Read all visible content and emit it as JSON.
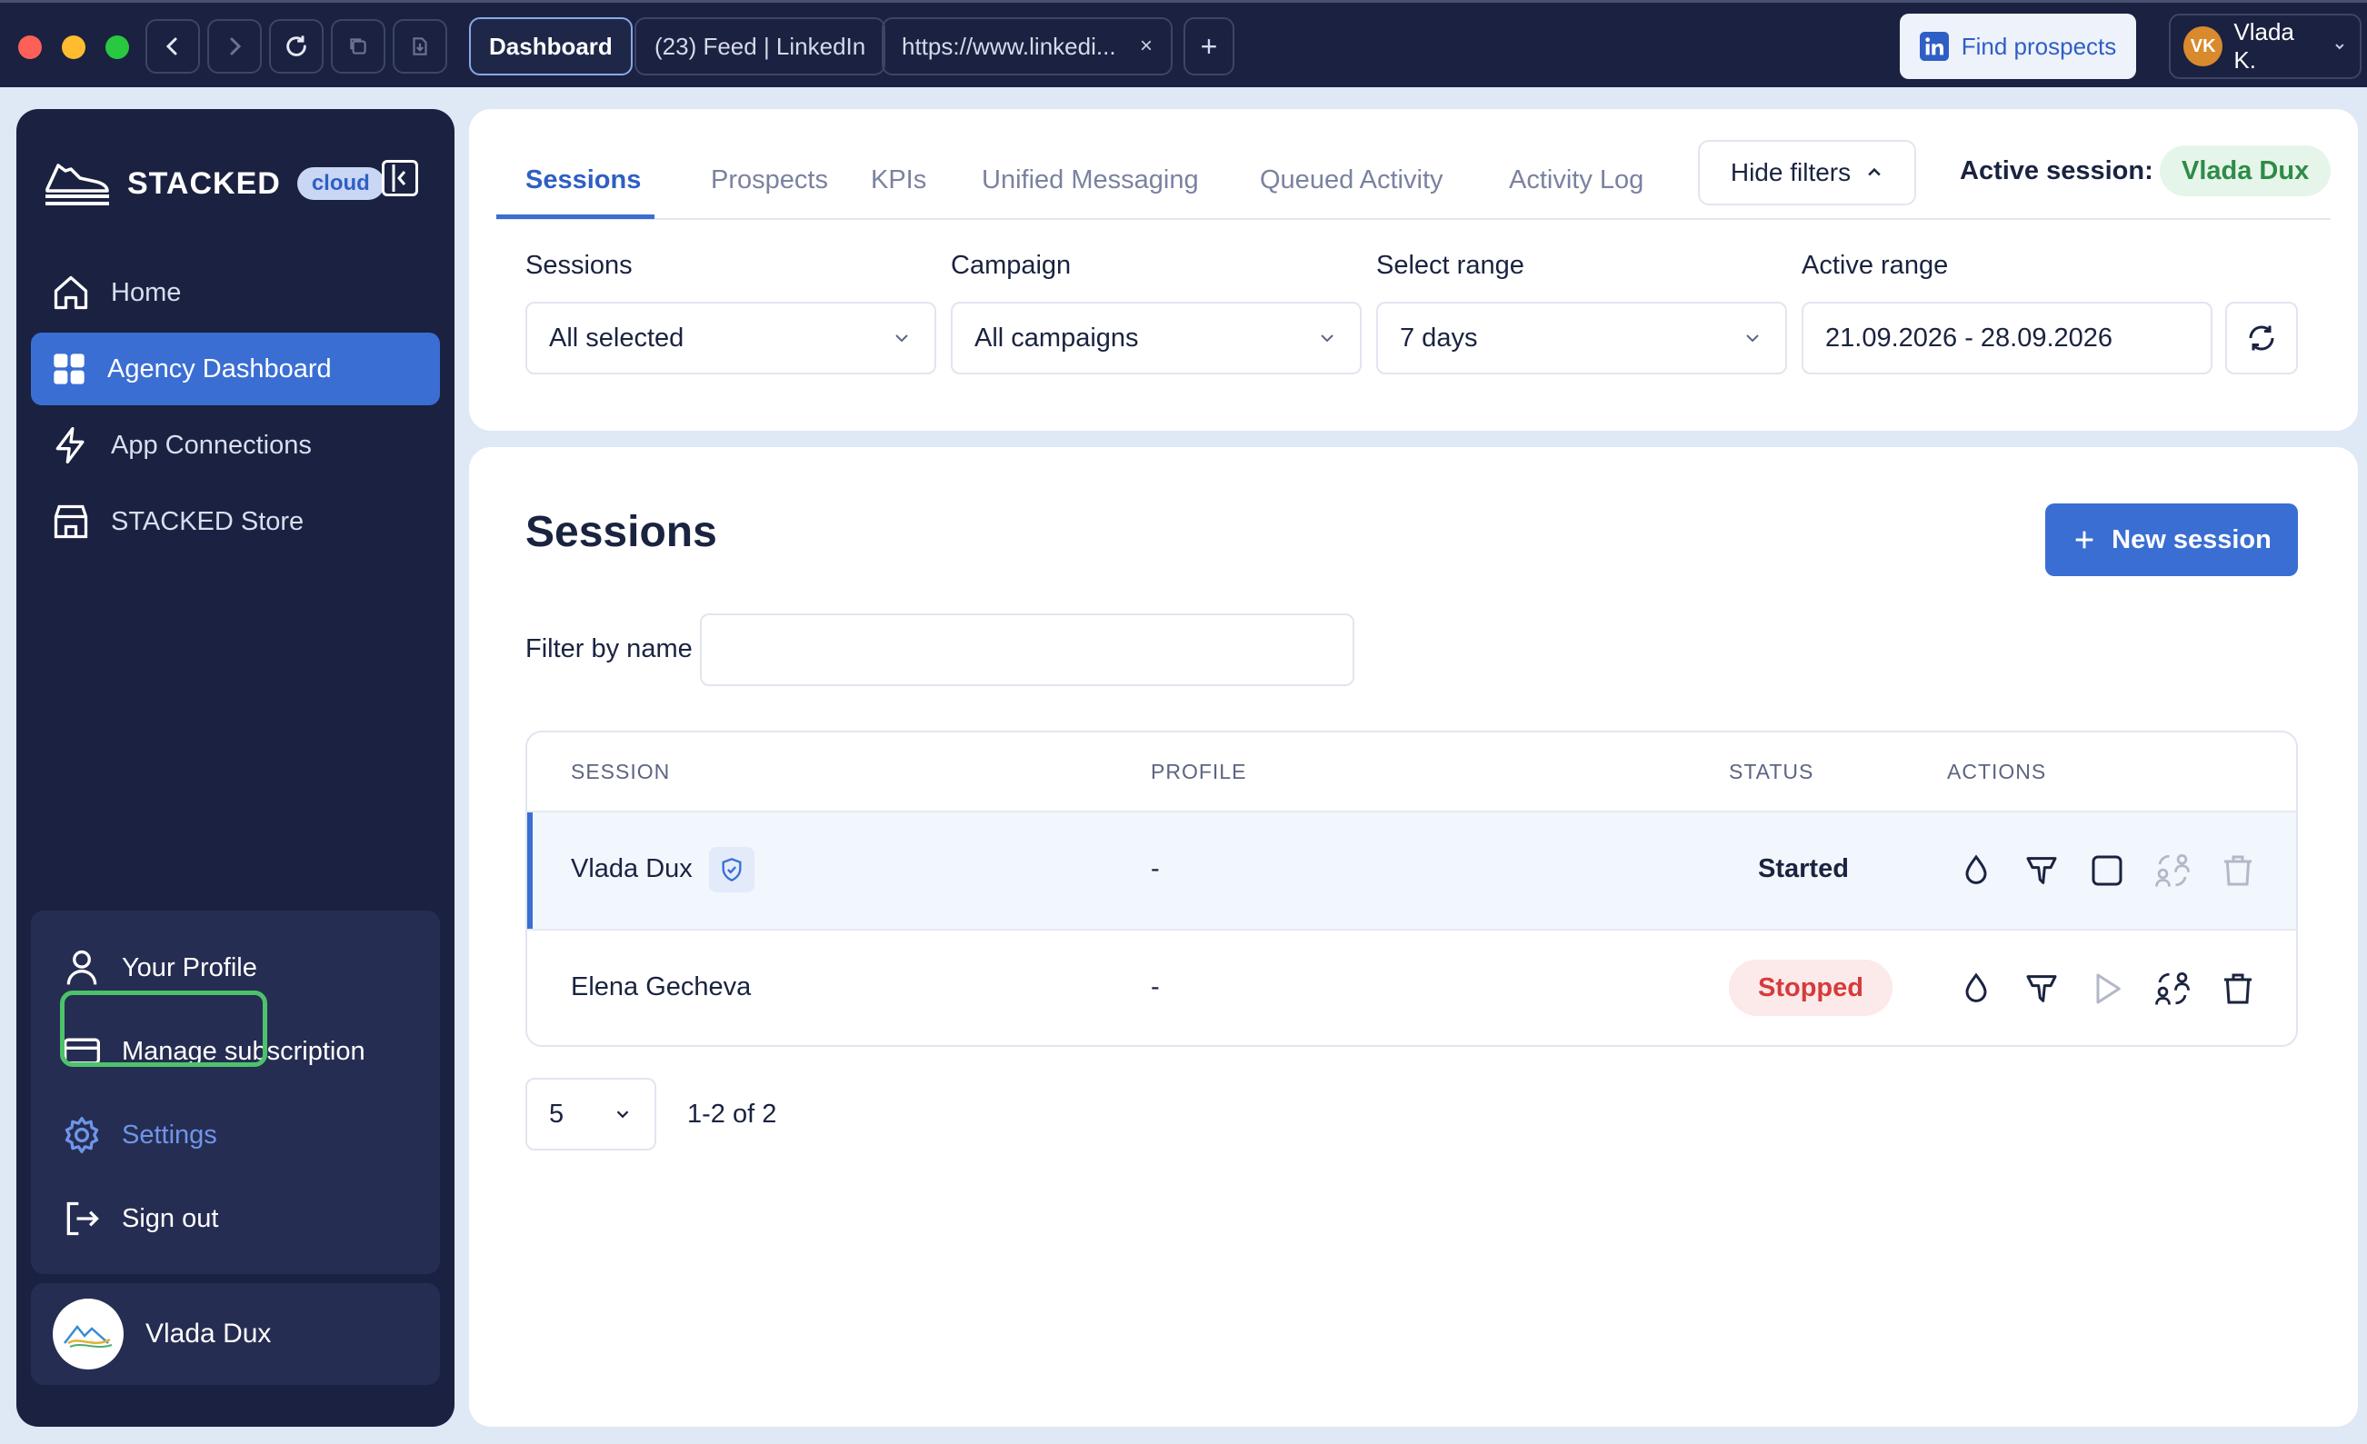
{
  "browser": {
    "tabs": [
      {
        "label": "Dashboard"
      },
      {
        "label": "(23) Feed | LinkedIn"
      },
      {
        "label": "https://www.linkedi...",
        "close": "×"
      }
    ],
    "new_tab": "+",
    "find_prospects": "Find prospects",
    "user_initials": "VK",
    "user_name": "Vlada K.",
    "colors": {
      "close": "#fe5f57",
      "minimize": "#febc2e",
      "maximize": "#28c840"
    }
  },
  "sidebar": {
    "brand": "STACKED",
    "brand_badge": "cloud",
    "nav": [
      {
        "label": "Home",
        "icon": "home-icon"
      },
      {
        "label": "Agency Dashboard",
        "icon": "grid-icon",
        "active": true
      },
      {
        "label": "App Connections",
        "icon": "lightning-icon"
      },
      {
        "label": "STACKED Store",
        "icon": "store-icon"
      }
    ],
    "account": [
      {
        "label": "Your Profile",
        "icon": "user-icon"
      },
      {
        "label": "Manage subscription",
        "icon": "credit-card-icon"
      },
      {
        "label": "Settings",
        "icon": "gear-icon",
        "highlighted": true
      },
      {
        "label": "Sign out",
        "icon": "sign-out-icon"
      }
    ],
    "user": "Vlada Dux"
  },
  "filters": {
    "tabs": [
      "Sessions",
      "Prospects",
      "KPIs",
      "Unified Messaging",
      "Queued Activity",
      "Activity Log"
    ],
    "active_tab": "Sessions",
    "hide_filters": "Hide filters",
    "active_session_label": "Active session:",
    "active_session_value": "Vlada Dux",
    "fields": [
      {
        "label": "Sessions",
        "value": "All selected"
      },
      {
        "label": "Campaign",
        "value": "All campaigns"
      },
      {
        "label": "Select range",
        "value": "7 days"
      },
      {
        "label": "Active range",
        "value": "21.09.2026 - 28.09.2026"
      }
    ]
  },
  "sessions": {
    "title": "Sessions",
    "new_session": "New session",
    "filter_label": "Filter by name",
    "filter_value": "",
    "columns": [
      "SESSION",
      "PROFILE",
      "STATUS",
      "ACTIONS"
    ],
    "rows": [
      {
        "name": "Vlada Dux",
        "profile": "-",
        "status": "Started",
        "selected": true
      },
      {
        "name": "Elena Gecheva",
        "profile": "-",
        "status": "Stopped",
        "selected": false
      }
    ],
    "page_size": "5",
    "page_info": "1-2 of 2"
  }
}
